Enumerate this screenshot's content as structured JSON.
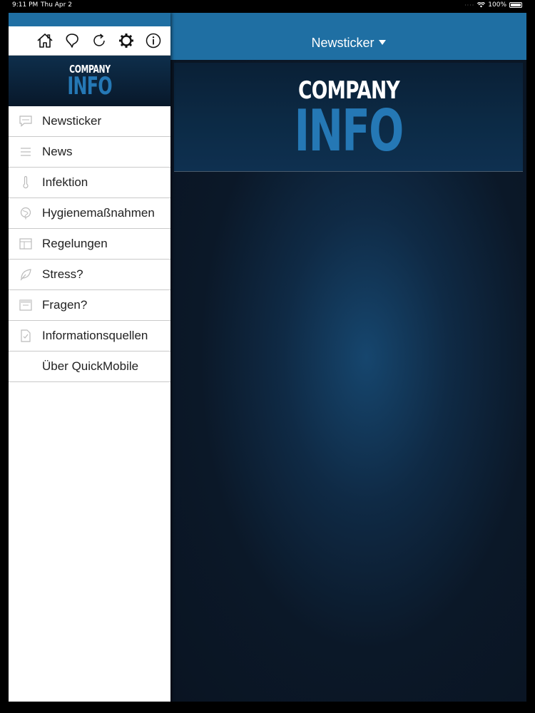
{
  "status_bar": {
    "time": "9:11 PM",
    "date": "Thu Apr 2",
    "battery": "100%"
  },
  "header": {
    "title": "Newsticker"
  },
  "logo": {
    "line1": "COMPANY",
    "line2": "INFO"
  },
  "toolbar": {
    "icons": [
      "home-icon",
      "balloon-icon",
      "refresh-icon",
      "gear-icon",
      "info-icon"
    ]
  },
  "menu": {
    "items": [
      {
        "label": "Newsticker",
        "icon": "chat-icon"
      },
      {
        "label": "News",
        "icon": "list-icon"
      },
      {
        "label": "Infektion",
        "icon": "thermometer-icon"
      },
      {
        "label": "Hygienemaßnahmen",
        "icon": "globe-icon"
      },
      {
        "label": "Regelungen",
        "icon": "table-icon"
      },
      {
        "label": "Stress?",
        "icon": "leaf-icon"
      },
      {
        "label": "Fragen?",
        "icon": "calendar-icon"
      },
      {
        "label": "Informationsquellen",
        "icon": "document-icon"
      },
      {
        "label": "Über QuickMobile",
        "icon": ""
      }
    ]
  },
  "colors": {
    "accent": "#1f6fa3",
    "logo_blue": "#2578b5",
    "dark_bg": "#0a1422"
  }
}
